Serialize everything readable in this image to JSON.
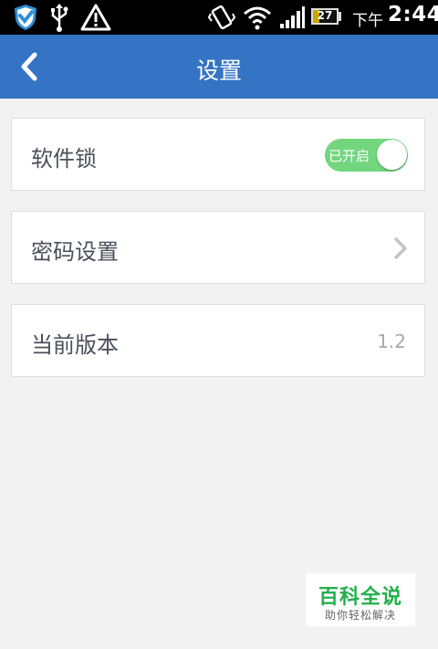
{
  "status_bar": {
    "battery_level": "27",
    "battery_fraction": 0.27,
    "time_prefix": "下午",
    "time": "2:44",
    "icons": [
      "shield-icon",
      "usb-icon",
      "warning-icon",
      "vibrate-icon",
      "wifi-icon",
      "signal-icon",
      "battery-icon"
    ]
  },
  "header": {
    "title": "设置",
    "back_icon": "back-arrow-icon"
  },
  "settings": {
    "software_lock": {
      "label": "软件锁",
      "toggle_label": "已开启",
      "toggle_on": true
    },
    "password": {
      "label": "密码设置",
      "icon": "chevron-right-icon"
    },
    "version": {
      "label": "当前版本",
      "value": "1.2"
    }
  },
  "watermark": {
    "main": "百科全说",
    "sub": "助你轻松解决"
  },
  "colors": {
    "header": "#3574c4",
    "toggle_on": "#72d67e",
    "watermark_green": "#22b04b",
    "background": "#f2f2f2"
  }
}
